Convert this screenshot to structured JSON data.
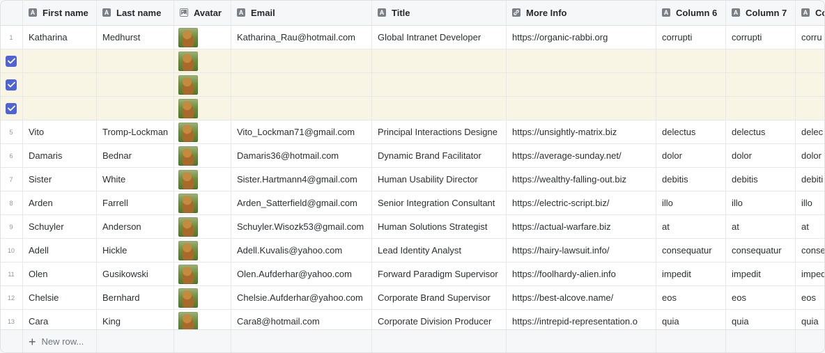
{
  "columns": [
    {
      "label": "First name",
      "icon": "text-type-icon"
    },
    {
      "label": "Last name",
      "icon": "text-type-icon"
    },
    {
      "label": "Avatar",
      "icon": "image-type-icon"
    },
    {
      "label": "Email",
      "icon": "text-type-icon"
    },
    {
      "label": "Title",
      "icon": "text-type-icon"
    },
    {
      "label": "More Info",
      "icon": "link-type-icon"
    },
    {
      "label": "Column 6",
      "icon": "text-type-icon"
    },
    {
      "label": "Column 7",
      "icon": "text-type-icon"
    },
    {
      "label": "Co",
      "icon": "text-type-icon"
    }
  ],
  "rows": [
    {
      "index": "1",
      "selected": false,
      "first": "Katharina",
      "last": "Medhurst",
      "email": "Katharina_Rau@hotmail.com",
      "title": "Global Intranet Developer",
      "info": "https://organic-rabbi.org",
      "c6": "corrupti",
      "c7": "corrupti",
      "c8": "corru"
    },
    {
      "index": "",
      "selected": true,
      "first": "",
      "last": "",
      "email": "",
      "title": "",
      "info": "",
      "c6": "",
      "c7": "",
      "c8": ""
    },
    {
      "index": "",
      "selected": true,
      "first": "",
      "last": "",
      "email": "",
      "title": "",
      "info": "",
      "c6": "",
      "c7": "",
      "c8": ""
    },
    {
      "index": "",
      "selected": true,
      "first": "",
      "last": "",
      "email": "",
      "title": "",
      "info": "",
      "c6": "",
      "c7": "",
      "c8": ""
    },
    {
      "index": "5",
      "selected": false,
      "first": "Vito",
      "last": "Tromp-Lockman",
      "email": "Vito_Lockman71@gmail.com",
      "title": "Principal Interactions Designe",
      "info": "https://unsightly-matrix.biz",
      "c6": "delectus",
      "c7": "delectus",
      "c8": "delec"
    },
    {
      "index": "6",
      "selected": false,
      "first": "Damaris",
      "last": "Bednar",
      "email": "Damaris36@hotmail.com",
      "title": "Dynamic Brand Facilitator",
      "info": "https://average-sunday.net/",
      "c6": "dolor",
      "c7": "dolor",
      "c8": "dolor"
    },
    {
      "index": "7",
      "selected": false,
      "first": "Sister",
      "last": "White",
      "email": "Sister.Hartmann4@gmail.com",
      "title": "Human Usability Director",
      "info": "https://wealthy-falling-out.biz",
      "c6": "debitis",
      "c7": "debitis",
      "c8": "debiti"
    },
    {
      "index": "8",
      "selected": false,
      "first": "Arden",
      "last": "Farrell",
      "email": "Arden_Satterfield@gmail.com",
      "title": "Senior Integration Consultant",
      "info": "https://electric-script.biz/",
      "c6": "illo",
      "c7": "illo",
      "c8": "illo"
    },
    {
      "index": "9",
      "selected": false,
      "first": "Schuyler",
      "last": "Anderson",
      "email": "Schuyler.Wisozk53@gmail.com",
      "title": "Human Solutions Strategist",
      "info": "https://actual-warfare.biz",
      "c6": "at",
      "c7": "at",
      "c8": "at"
    },
    {
      "index": "10",
      "selected": false,
      "first": "Adell",
      "last": "Hickle",
      "email": "Adell.Kuvalis@yahoo.com",
      "title": "Lead Identity Analyst",
      "info": "https://hairy-lawsuit.info/",
      "c6": "consequatur",
      "c7": "consequatur",
      "c8": "conse"
    },
    {
      "index": "11",
      "selected": false,
      "first": "Olen",
      "last": "Gusikowski",
      "email": "Olen.Aufderhar@yahoo.com",
      "title": "Forward Paradigm Supervisor",
      "info": "https://foolhardy-alien.info",
      "c6": "impedit",
      "c7": "impedit",
      "c8": "imped"
    },
    {
      "index": "12",
      "selected": false,
      "first": "Chelsie",
      "last": "Bernhard",
      "email": "Chelsie.Aufderhar@yahoo.com",
      "title": "Corporate Brand Supervisor",
      "info": "https://best-alcove.name/",
      "c6": "eos",
      "c7": "eos",
      "c8": "eos"
    },
    {
      "index": "13",
      "selected": false,
      "first": "Cara",
      "last": "King",
      "email": "Cara8@hotmail.com",
      "title": "Corporate Division Producer",
      "info": "https://intrepid-representation.o",
      "c6": "quia",
      "c7": "quia",
      "c8": "quia"
    }
  ],
  "footer": {
    "new_row_label": "New row..."
  },
  "colors": {
    "selected_row": "#f8f5e4",
    "checkbox": "#4e63d8",
    "header_bg": "#f6f7f8",
    "border": "#e6e8eb"
  }
}
